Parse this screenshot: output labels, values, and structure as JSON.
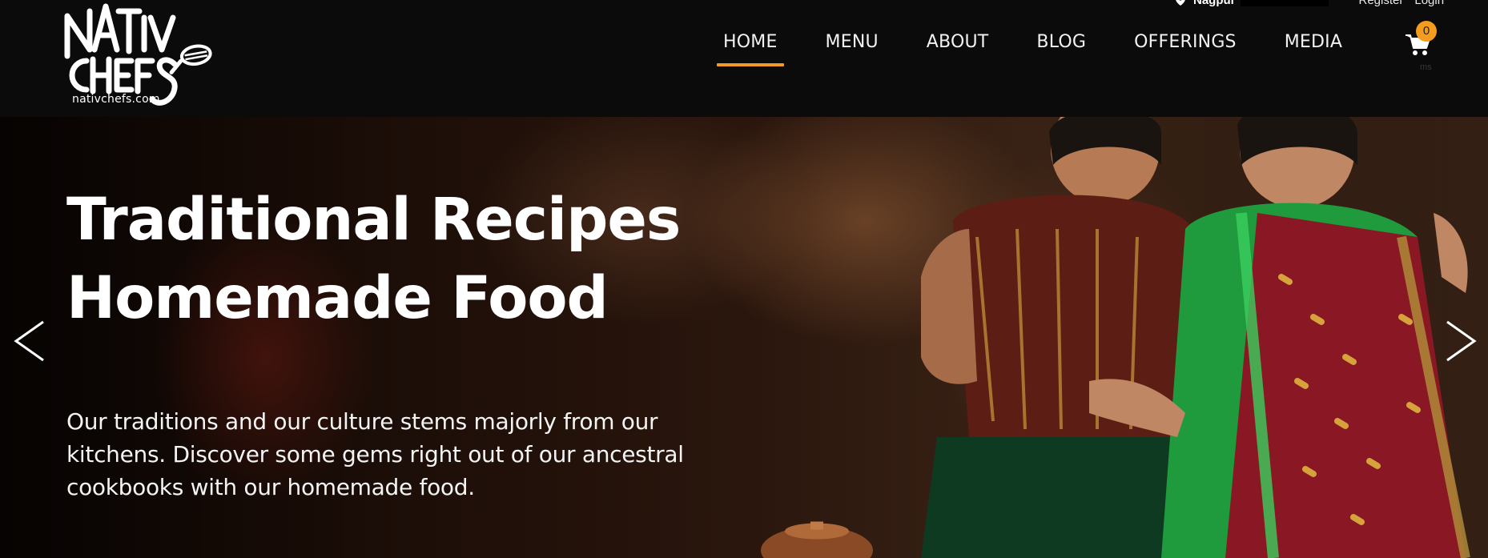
{
  "brand": {
    "logo_line1": "NATIV",
    "logo_line2": "CHEFS",
    "domain": "nativchefs.com"
  },
  "topbar": {
    "city": "Nagpur",
    "register": "Register",
    "login": "Login"
  },
  "nav": {
    "items": [
      {
        "label": "HOME",
        "active": true
      },
      {
        "label": "MENU",
        "active": false
      },
      {
        "label": "ABOUT",
        "active": false
      },
      {
        "label": "BLOG",
        "active": false
      },
      {
        "label": "OFFERINGS",
        "active": false
      },
      {
        "label": "MEDIA",
        "active": false
      }
    ],
    "accent_color": "#f09a28"
  },
  "cart": {
    "icon": "cart-icon",
    "count": "0",
    "sub_text": "ms"
  },
  "hero": {
    "title_line1": "Traditional Recipes",
    "title_line2": "Homemade Food",
    "description": "Our traditions and our culture stems majorly from our kitchens. Discover some gems right out of our ancestral cookbooks with our homemade food.",
    "prev_icon": "chevron-left-icon",
    "next_icon": "chevron-right-icon"
  }
}
